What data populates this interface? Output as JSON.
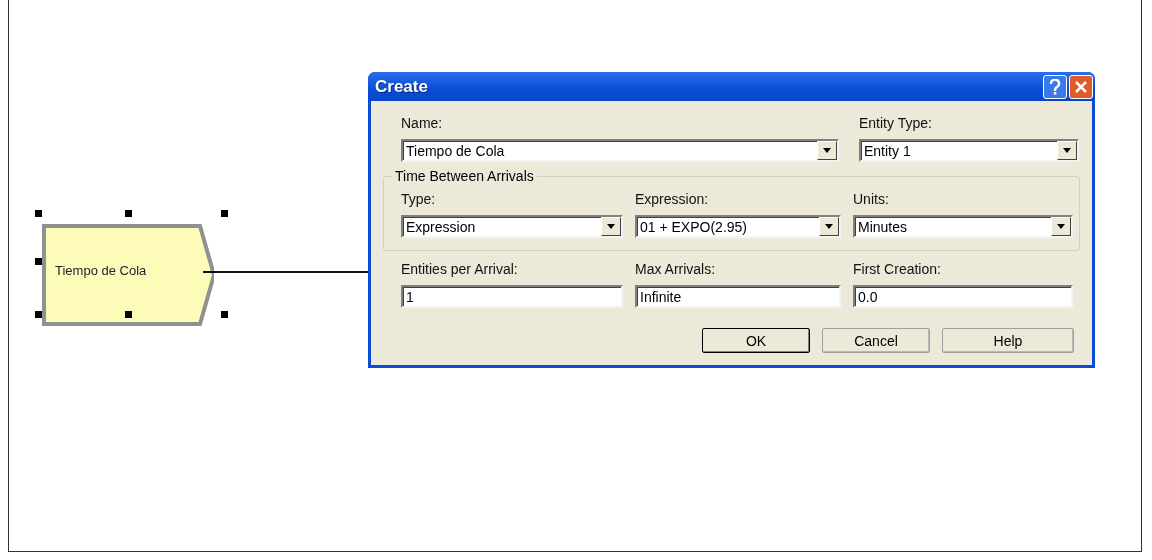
{
  "canvas": {
    "module": {
      "label": "Tiempo de Cola",
      "selected": true
    }
  },
  "dialog": {
    "title": "Create",
    "top_fields": [
      {
        "label": "Name:",
        "value": "Tiempo de Cola",
        "kind": "combo"
      },
      {
        "label": "Entity Type:",
        "value": "Entity 1",
        "kind": "combo"
      }
    ],
    "group": {
      "title": "Time Between Arrivals",
      "fields": [
        {
          "label": "Type:",
          "value": "Expression",
          "kind": "combo"
        },
        {
          "label": "Expression:",
          "value": "01 + EXPO(2.95)",
          "kind": "combo"
        },
        {
          "label": "Units:",
          "value": "Minutes",
          "kind": "combo"
        }
      ]
    },
    "fields": [
      {
        "label": "Entities per Arrival:",
        "value": "1",
        "kind": "text"
      },
      {
        "label": "Max Arrivals:",
        "value": "Infinite",
        "kind": "text"
      },
      {
        "label": "First Creation:",
        "value": "0.0",
        "kind": "text"
      }
    ],
    "buttons": [
      {
        "label": "OK",
        "default": true
      },
      {
        "label": "Cancel",
        "default": false
      },
      {
        "label": "Help",
        "default": false
      }
    ]
  }
}
